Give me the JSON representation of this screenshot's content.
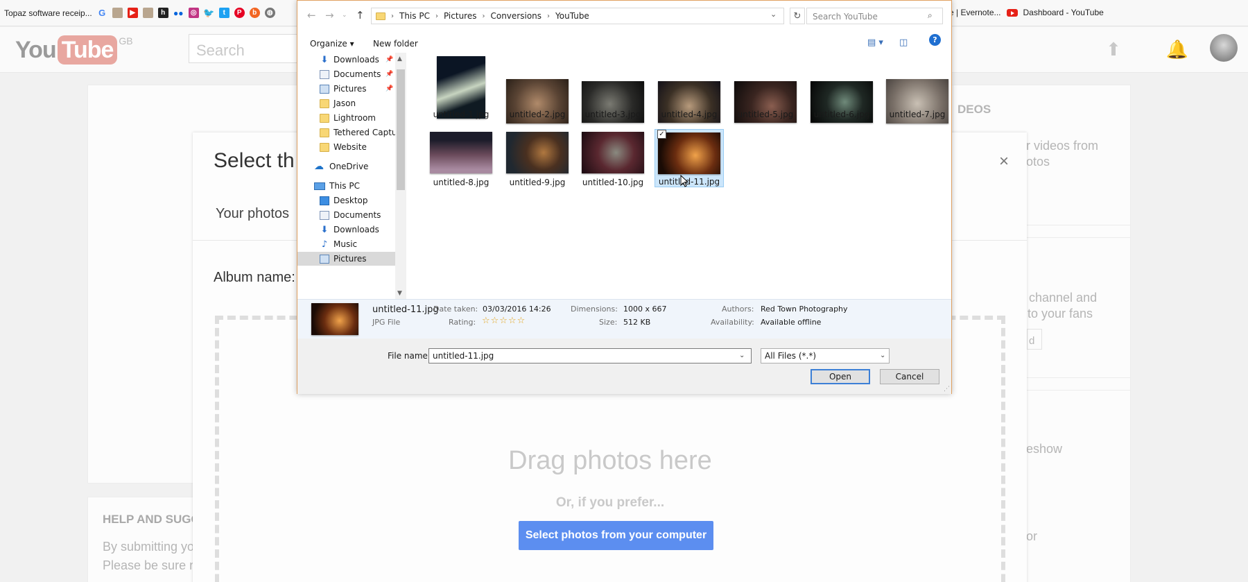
{
  "bookmarks": {
    "first": "Topaz software receip...",
    "evernote": "e | Evernote...",
    "dashboard": "Dashboard - YouTube"
  },
  "youtube": {
    "logo_you": "You",
    "logo_tube": "Tube",
    "region": "GB",
    "search_placeholder": "Search"
  },
  "background": {
    "videos_heading_fragment": "DEOS",
    "side1_line1": "r videos from",
    "side1_line2": "otos",
    "side2_line1": "channel and",
    "side2_line2": "to your fans",
    "side2_button": "d",
    "side3": "eshow",
    "side4": "or",
    "help_heading": "HELP AND SUGG",
    "help_line1": "By submitting yo",
    "help_line2": "Please be sure n"
  },
  "modal": {
    "title": "Select th",
    "tab": "Your photos",
    "album_label": "Album name:",
    "close": "×",
    "drag_text": "Drag photos here",
    "or_text": "Or, if you prefer...",
    "select_button": "Select photos from your computer"
  },
  "dialog": {
    "breadcrumb": [
      "This PC",
      "Pictures",
      "Conversions",
      "YouTube"
    ],
    "search_placeholder": "Search YouTube",
    "organize": "Organize",
    "new_folder": "New folder",
    "nav": [
      {
        "label": "Downloads",
        "icon": "downloads-icon",
        "pinned": true
      },
      {
        "label": "Documents",
        "icon": "documents-icon",
        "pinned": true
      },
      {
        "label": "Pictures",
        "icon": "pictures-icon",
        "pinned": true
      },
      {
        "label": "Jason",
        "icon": "folder-icon"
      },
      {
        "label": "Lightroom",
        "icon": "folder-icon"
      },
      {
        "label": "Tethered Captur",
        "icon": "folder-icon"
      },
      {
        "label": "Website",
        "icon": "folder-icon"
      },
      {
        "label": "OneDrive",
        "icon": "onedrive-icon"
      },
      {
        "label": "This PC",
        "icon": "this-pc-icon"
      },
      {
        "label": "Desktop",
        "icon": "desktop-icon"
      },
      {
        "label": "Documents",
        "icon": "documents-icon"
      },
      {
        "label": "Downloads",
        "icon": "downloads-icon"
      },
      {
        "label": "Music",
        "icon": "music-icon"
      },
      {
        "label": "Pictures",
        "icon": "pictures-icon",
        "selected": true
      }
    ],
    "files": [
      "untitled-1.jpg",
      "untitled-2.jpg",
      "untitled-3.jpg",
      "untitled-4.jpg",
      "untitled-5.jpg",
      "untitled-6.jpg",
      "untitled-7.jpg",
      "untitled-8.jpg",
      "untitled-9.jpg",
      "untitled-10.jpg",
      "untitled-11.jpg"
    ],
    "selected_file": "untitled-11.jpg",
    "details": {
      "name": "untitled-11.jpg",
      "type": "JPG File",
      "date_taken_label": "Date taken:",
      "date_taken": "03/03/2016 14:26",
      "rating_label": "Rating:",
      "rating_stars": 5,
      "dimensions_label": "Dimensions:",
      "dimensions": "1000 x 667",
      "size_label": "Size:",
      "size": "512 KB",
      "authors_label": "Authors:",
      "authors": "Red Town Photography",
      "availability_label": "Availability:",
      "availability": "Available offline"
    },
    "file_name_label": "File name:",
    "file_name_value": "untitled-11.jpg",
    "file_type": "All Files (*.*)",
    "open_label": "Open",
    "cancel_label": "Cancel"
  },
  "colors": {
    "accent_blue": "#5c8ef0",
    "selection_blue": "#cce6fb",
    "dialog_border": "#e0a060"
  }
}
